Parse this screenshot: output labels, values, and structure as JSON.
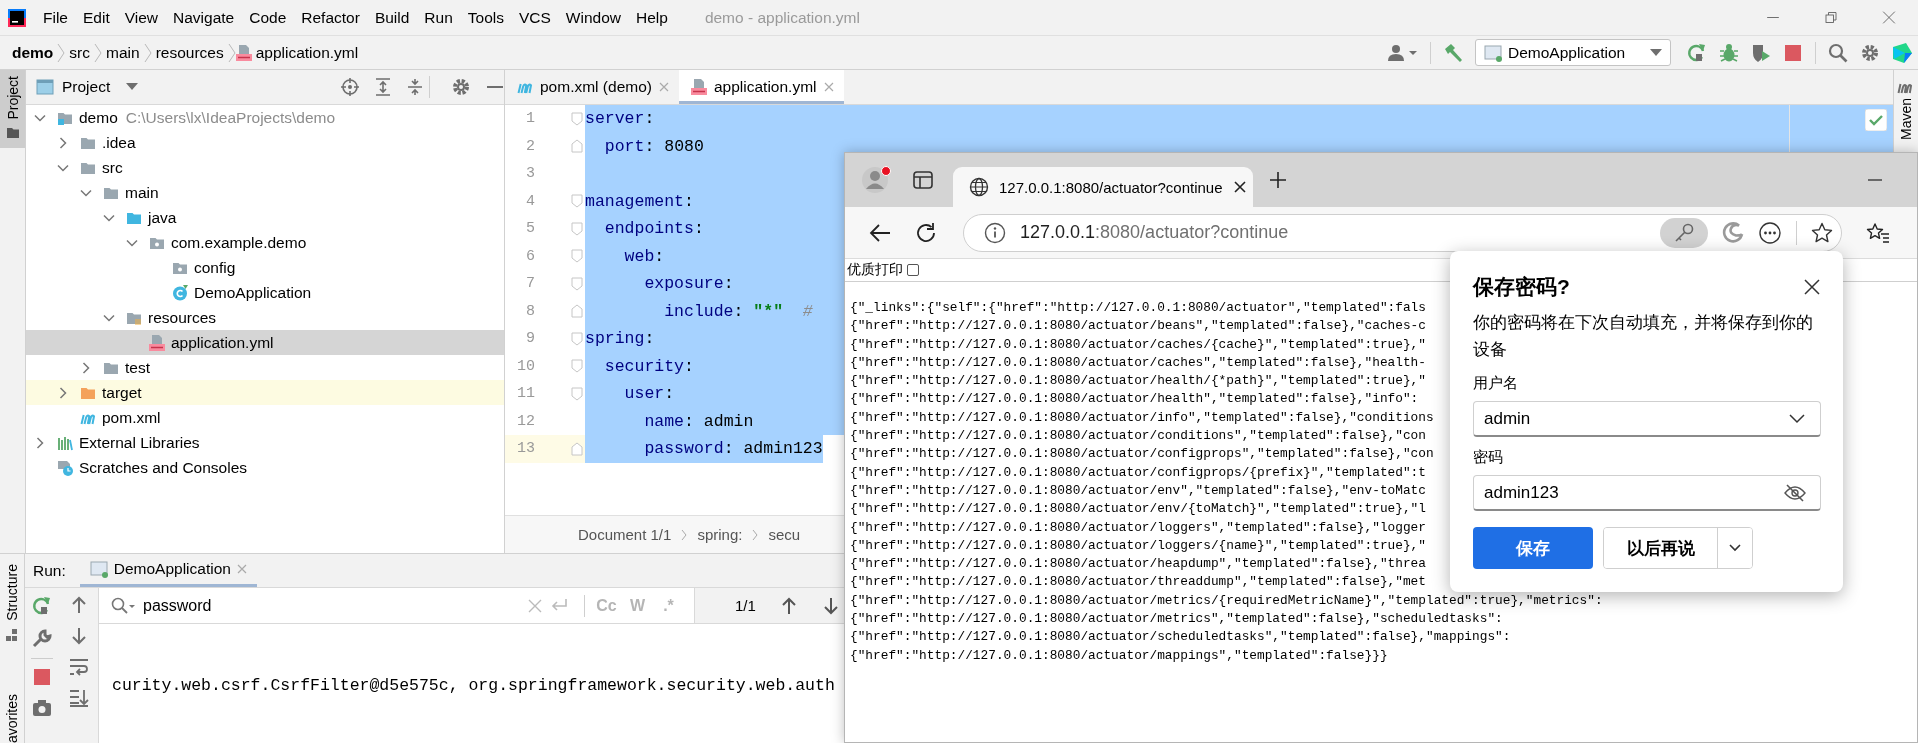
{
  "ide": {
    "menu": [
      "File",
      "Edit",
      "View",
      "Navigate",
      "Code",
      "Refactor",
      "Build",
      "Run",
      "Tools",
      "VCS",
      "Window",
      "Help"
    ],
    "window_title": "demo - application.yml",
    "breadcrumb": [
      "demo",
      "src",
      "main",
      "resources",
      "application.yml"
    ],
    "run_configuration": "DemoApplication",
    "tool_strip": {
      "project_tab": {
        "label": "Project",
        "selected": true
      },
      "bottom_tabs": [
        "Structure",
        "avorites"
      ],
      "right_tabs": [
        "Maven"
      ]
    },
    "project_panel": {
      "title": "Project",
      "tree": [
        {
          "label": "demo",
          "kind": "module",
          "path": "C:\\Users\\lx\\IdeaProjects\\demo",
          "expanded": true,
          "selected": false,
          "excluded": false,
          "children": [
            {
              "label": ".idea",
              "kind": "folder",
              "expanded": false,
              "selected": false,
              "excluded": false
            },
            {
              "label": "src",
              "kind": "folder",
              "expanded": true,
              "selected": false,
              "excluded": false,
              "children": [
                {
                  "label": "main",
                  "kind": "folder",
                  "expanded": true,
                  "selected": false,
                  "excluded": false,
                  "children": [
                    {
                      "label": "java",
                      "kind": "source-folder",
                      "expanded": true,
                      "selected": false,
                      "excluded": false,
                      "children": [
                        {
                          "label": "com.example.demo",
                          "kind": "package",
                          "expanded": true,
                          "selected": false,
                          "excluded": false,
                          "children": [
                            {
                              "label": "config",
                              "kind": "package",
                              "selected": false,
                              "excluded": false
                            },
                            {
                              "label": "DemoApplication",
                              "kind": "class",
                              "selected": false,
                              "excluded": false
                            }
                          ]
                        }
                      ]
                    },
                    {
                      "label": "resources",
                      "kind": "resources-folder",
                      "expanded": true,
                      "selected": false,
                      "excluded": false,
                      "children": [
                        {
                          "label": "application.yml",
                          "kind": "yml-file",
                          "selected": true,
                          "excluded": false
                        }
                      ]
                    }
                  ]
                },
                {
                  "label": "test",
                  "kind": "folder",
                  "expanded": false,
                  "selected": false,
                  "excluded": false
                }
              ]
            },
            {
              "label": "target",
              "kind": "excluded-folder",
              "expanded": false,
              "selected": false,
              "excluded": true
            },
            {
              "label": "pom.xml",
              "kind": "maven-file",
              "selected": false,
              "excluded": false
            }
          ]
        },
        {
          "label": "External Libraries",
          "kind": "libraries",
          "expanded": false,
          "selected": false,
          "excluded": false
        },
        {
          "label": "Scratches and Consoles",
          "kind": "scratches",
          "selected": false,
          "excluded": false
        }
      ]
    },
    "editor": {
      "tabs": [
        {
          "label": "pom.xml (demo)",
          "kind": "maven-file",
          "selected": false
        },
        {
          "label": "application.yml",
          "kind": "yml-file",
          "selected": true
        }
      ],
      "lines": [
        {
          "number": "1",
          "kind": "fold-start",
          "selected": true,
          "current": false,
          "tokens": [
            {
              "kind": "key",
              "text": "server"
            },
            {
              "kind": "plain",
              "text": ":"
            }
          ]
        },
        {
          "number": "2",
          "kind": "fold-end",
          "selected": true,
          "current": false,
          "tokens": [
            {
              "kind": "key",
              "text": "  port"
            },
            {
              "kind": "plain",
              "text": ": 8080"
            }
          ]
        },
        {
          "number": "3",
          "selected": true,
          "current": false
        },
        {
          "number": "4",
          "kind": "fold-start",
          "selected": true,
          "current": false,
          "tokens": [
            {
              "kind": "key",
              "text": "management"
            },
            {
              "kind": "plain",
              "text": ":"
            }
          ]
        },
        {
          "number": "5",
          "kind": "fold-start",
          "selected": true,
          "current": false,
          "tokens": [
            {
              "kind": "key",
              "text": "  endpoints"
            },
            {
              "kind": "plain",
              "text": ":"
            }
          ]
        },
        {
          "number": "6",
          "kind": "fold-start",
          "selected": true,
          "current": false,
          "tokens": [
            {
              "kind": "key",
              "text": "    web"
            },
            {
              "kind": "plain",
              "text": ":"
            }
          ]
        },
        {
          "number": "7",
          "kind": "fold-start",
          "selected": true,
          "current": false,
          "tokens": [
            {
              "kind": "key",
              "text": "      exposure"
            },
            {
              "kind": "plain",
              "text": ":"
            }
          ]
        },
        {
          "number": "8",
          "kind": "fold-end",
          "selected": true,
          "current": false,
          "tokens": [
            {
              "kind": "key",
              "text": "        include"
            },
            {
              "kind": "plain",
              "text": ": "
            },
            {
              "kind": "string",
              "text": "\"*\""
            },
            {
              "kind": "comment",
              "text": "  #"
            }
          ]
        },
        {
          "number": "9",
          "kind": "fold-start",
          "selected": true,
          "current": false,
          "tokens": [
            {
              "kind": "key",
              "text": "spring"
            },
            {
              "kind": "plain",
              "text": ":"
            }
          ]
        },
        {
          "number": "10",
          "kind": "fold-start",
          "selected": true,
          "current": false,
          "tokens": [
            {
              "kind": "key",
              "text": "  security"
            },
            {
              "kind": "plain",
              "text": ":"
            }
          ]
        },
        {
          "number": "11",
          "kind": "fold-start",
          "selected": true,
          "current": false,
          "tokens": [
            {
              "kind": "key",
              "text": "    user"
            },
            {
              "kind": "plain",
              "text": ":"
            }
          ]
        },
        {
          "number": "12",
          "selected": true,
          "current": false,
          "tokens": [
            {
              "kind": "key",
              "text": "      name"
            },
            {
              "kind": "plain",
              "text": ": admin"
            }
          ]
        },
        {
          "number": "13",
          "kind": "fold-end",
          "selected": true,
          "current": true,
          "tokens": [
            {
              "kind": "key",
              "text": "      password"
            },
            {
              "kind": "plain",
              "text": ": admin123"
            }
          ]
        }
      ],
      "breadcrumb": [
        "Document 1/1",
        "spring:",
        "secu"
      ]
    },
    "run_panel": {
      "label": "Run:",
      "tabs": [
        {
          "label": "DemoApplication",
          "selected": true
        }
      ],
      "search": {
        "value": "password",
        "options": [
          "Cc",
          "W",
          ".*"
        ],
        "match_count": "1/1"
      },
      "console": [
        "curity.web.csrf.CsrfFilter@d5e575c, org.springframework.security.web.auth"
      ]
    }
  },
  "browser": {
    "tabs": [
      {
        "title": "127.0.0.1:8080/actuator?continue",
        "selected": true
      }
    ],
    "address": {
      "host": "127.0.0.1",
      "rest": ":8080/actuator?continue"
    },
    "print_option": {
      "label": "优质打印",
      "checked": false
    },
    "json_lines": [
      "{\"_links\":{\"self\":{\"href\":\"http://127.0.0.1:8080/actuator\",\"templated\":fals",
      "{\"href\":\"http://127.0.0.1:8080/actuator/beans\",\"templated\":false},\"caches-c",
      "{\"href\":\"http://127.0.0.1:8080/actuator/caches/{cache}\",\"templated\":true},\"",
      "{\"href\":\"http://127.0.0.1:8080/actuator/caches\",\"templated\":false},\"health-",
      "{\"href\":\"http://127.0.0.1:8080/actuator/health/{*path}\",\"templated\":true},\"",
      "{\"href\":\"http://127.0.0.1:8080/actuator/health\",\"templated\":false},\"info\":",
      "{\"href\":\"http://127.0.0.1:8080/actuator/info\",\"templated\":false},\"conditions",
      "{\"href\":\"http://127.0.0.1:8080/actuator/conditions\",\"templated\":false},\"con",
      "{\"href\":\"http://127.0.0.1:8080/actuator/configprops\",\"templated\":false},\"con",
      "{\"href\":\"http://127.0.0.1:8080/actuator/configprops/{prefix}\",\"templated\":t",
      "{\"href\":\"http://127.0.0.1:8080/actuator/env\",\"templated\":false},\"env-toMatc",
      "{\"href\":\"http://127.0.0.1:8080/actuator/env/{toMatch}\",\"templated\":true},\"l",
      "{\"href\":\"http://127.0.0.1:8080/actuator/loggers\",\"templated\":false},\"logger",
      "{\"href\":\"http://127.0.0.1:8080/actuator/loggers/{name}\",\"templated\":true},\"",
      "{\"href\":\"http://127.0.0.1:8080/actuator/heapdump\",\"templated\":false},\"threa",
      "{\"href\":\"http://127.0.0.1:8080/actuator/threaddump\",\"templated\":false},\"met",
      "{\"href\":\"http://127.0.0.1:8080/actuator/metrics/{requiredMetricName}\",\"templated\":true},\"metrics\":",
      "{\"href\":\"http://127.0.0.1:8080/actuator/metrics\",\"templated\":false},\"scheduledtasks\":",
      "{\"href\":\"http://127.0.0.1:8080/actuator/scheduledtasks\",\"templated\":false},\"mappings\":",
      "{\"href\":\"http://127.0.0.1:8080/actuator/mappings\",\"templated\":false}}}"
    ]
  },
  "password_dialog": {
    "title": "保存密码?",
    "message": "你的密码将在下次自动填充，并将保存到你的设备",
    "username_label": "用户名",
    "username": "admin",
    "password_label": "密码",
    "password": "admin123",
    "save_button": "保存",
    "later_button": "以后再说"
  }
}
